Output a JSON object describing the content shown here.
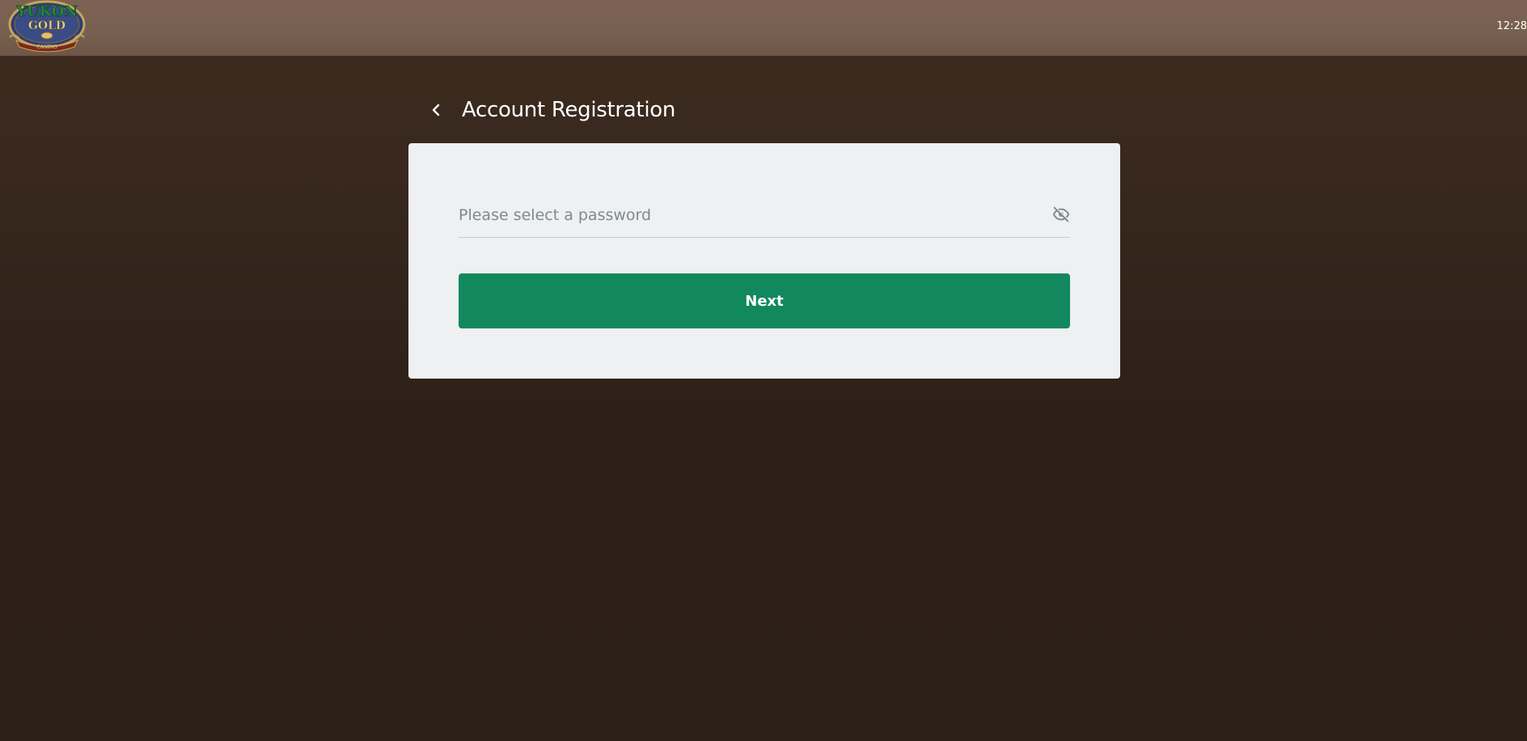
{
  "header": {
    "logo_name": "yukon-gold-casino-logo",
    "logo_text": {
      "line1": "YUKON",
      "line2": "GOLD",
      "line3": "CASINO"
    },
    "clock": "12:28"
  },
  "page": {
    "title": "Account Registration",
    "back_icon": "chevron-left-icon"
  },
  "form": {
    "password": {
      "placeholder": "Please select a password",
      "value": "",
      "toggle_icon": "eye-off-icon"
    },
    "next_label": "Next"
  },
  "colors": {
    "topbar": "#7c6252",
    "background": "#2d2018",
    "card": "#eef0f2",
    "primary_button": "#11885e"
  }
}
